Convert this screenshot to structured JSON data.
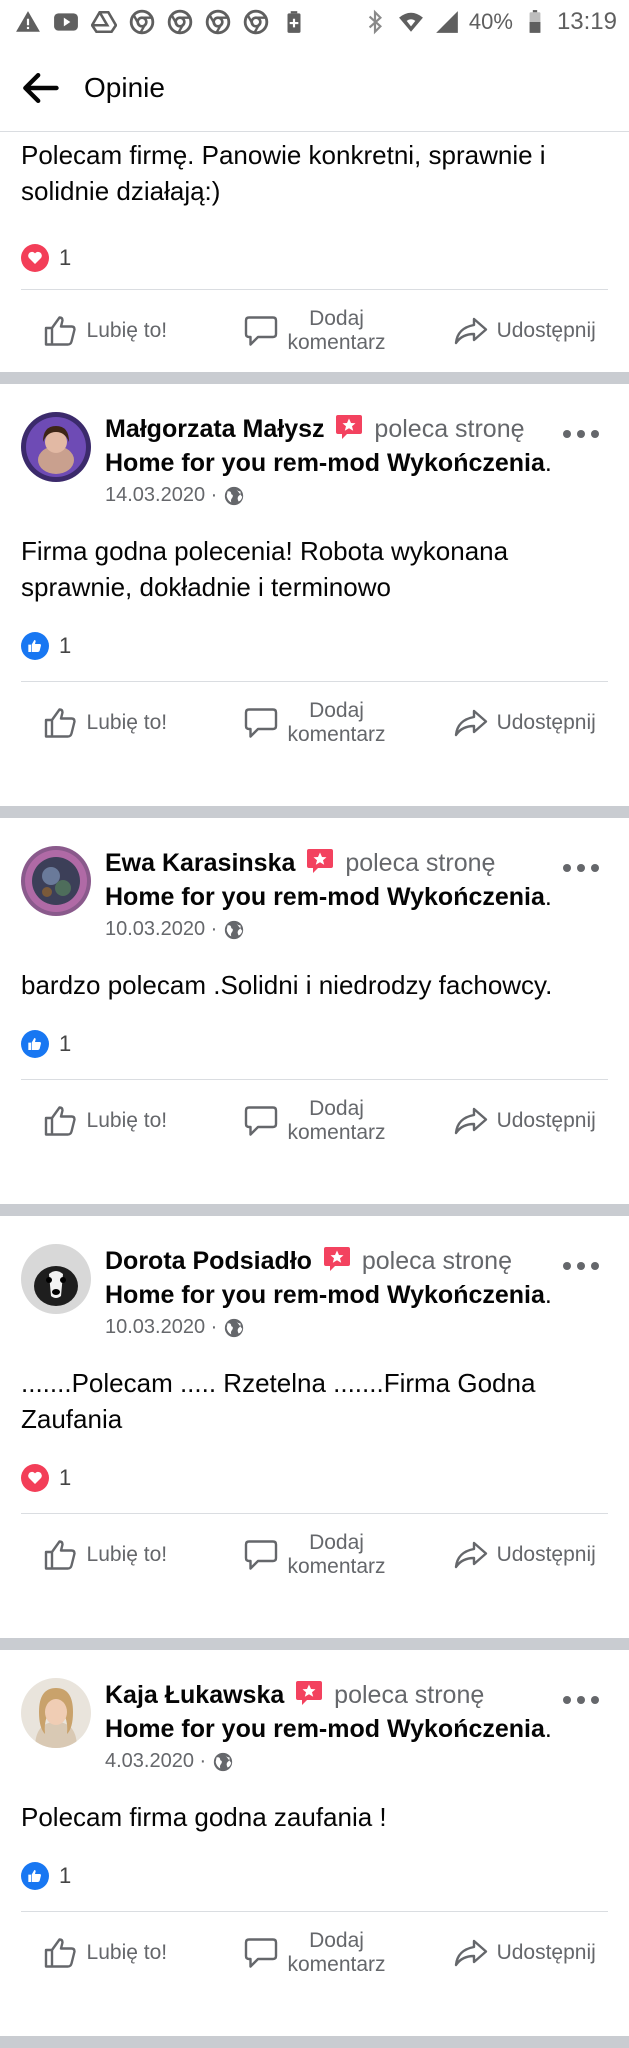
{
  "status_bar": {
    "battery": "40%",
    "time": "13:19"
  },
  "header": {
    "title": "Opinie"
  },
  "actions": {
    "like": "Lubię to!",
    "comment_line1": "Dodaj",
    "comment_line2": "komentarz",
    "share": "Udostępnij"
  },
  "posts": [
    {
      "text": "Polecam firmę. Panowie konkretni, sprawnie i solidnie działają:)",
      "reaction": "love",
      "reaction_count": "1"
    },
    {
      "author": "Małgorzata Małysz",
      "recommends": "poleca stronę",
      "page": "Home for you   rem-mod Wykończenia",
      "date": "14.03.2020 ·",
      "text": "Firma godna polecenia! Robota wykonana sprawnie, dokładnie i terminowo",
      "reaction": "like",
      "reaction_count": "1"
    },
    {
      "author": "Ewa Karasinska",
      "recommends": "poleca stronę",
      "page": "Home for you   rem-mod Wykończenia",
      "date": "10.03.2020 ·",
      "text": "bardzo polecam .Solidni i niedrodzy fachowcy.",
      "reaction": "like",
      "reaction_count": "1"
    },
    {
      "author": "Dorota Podsiadło",
      "recommends": "poleca stronę",
      "page": "Home for you   rem-mod Wykończenia",
      "date": "10.03.2020 ·",
      "text": ".......Polecam ..... Rzetelna .......Firma Godna Zaufania",
      "reaction": "love",
      "reaction_count": "1"
    },
    {
      "author": "Kaja Łukawska",
      "recommends": "poleca stronę",
      "page": "Home for you   rem-mod Wykończenia",
      "date": "4.03.2020 ·",
      "text": "Polecam firma godna zaufania !",
      "reaction": "like",
      "reaction_count": "1"
    }
  ],
  "colors": {
    "like_blue": "#1877f2",
    "love_red": "#f33e58",
    "badge_pink": "#f3425f",
    "muted_text": "#65676b",
    "separator_band": "#c9ccd1"
  }
}
